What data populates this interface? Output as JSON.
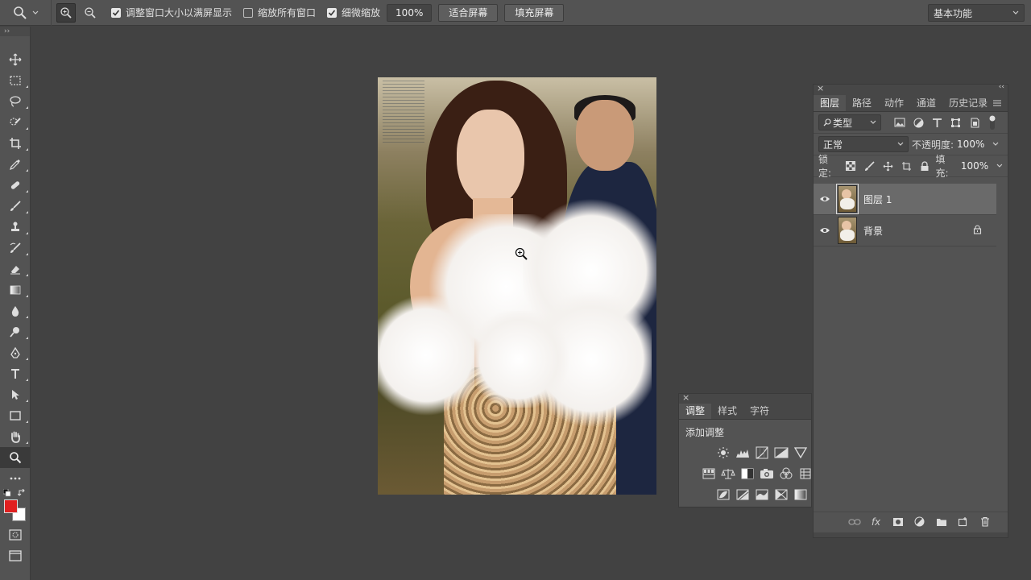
{
  "options_bar": {
    "fit_window_label": "调整窗口大小以满屏显示",
    "zoom_all_label": "缩放所有窗口",
    "scrubby_label": "细微缩放",
    "zoom_value": "100%",
    "fit_screen_label": "适合屏幕",
    "fill_screen_label": "填充屏幕",
    "workspace": "基本功能"
  },
  "colors": {
    "foreground": "#e02020",
    "background": "#ffffff",
    "ui_panel": "#535353",
    "workspace_bg": "#424242"
  },
  "toolbar": {
    "collapse": "››"
  },
  "adjustments_panel": {
    "tabs": [
      "调整",
      "样式",
      "字符"
    ],
    "title": "添加调整"
  },
  "layers_panel": {
    "tabs": [
      "图层",
      "路径",
      "动作",
      "通道",
      "历史记录"
    ],
    "filter_kind": "类型",
    "blend_mode": "正常",
    "opacity_label": "不透明度:",
    "opacity_value": "100%",
    "lock_label": "锁定:",
    "fill_label": "填充:",
    "fill_value": "100%",
    "layers": [
      {
        "name": "图层 1",
        "selected": true
      },
      {
        "name": "背景",
        "selected": false,
        "locked": true
      }
    ],
    "footer_fx": "fx"
  }
}
